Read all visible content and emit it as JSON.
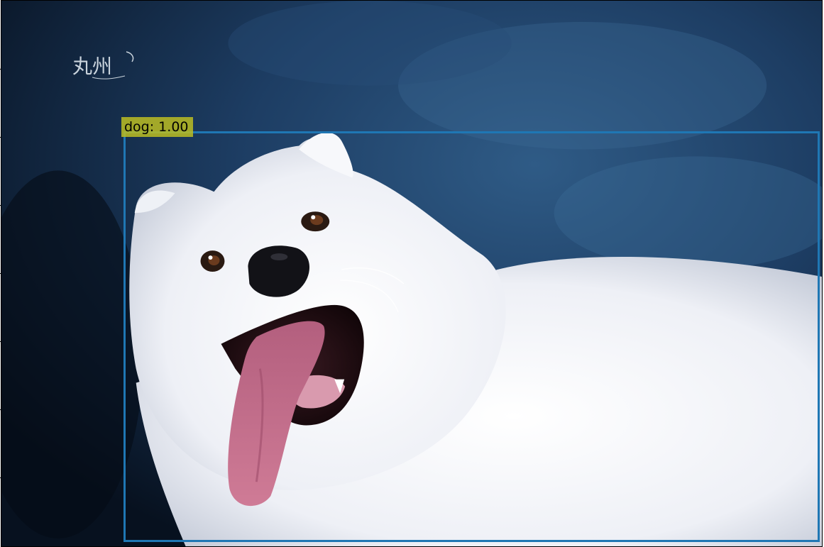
{
  "watermark": {
    "text": "丸州"
  },
  "detections": [
    {
      "label": "dog: 1.00",
      "class": "dog",
      "score": 1.0
    }
  ],
  "colors": {
    "box": "#1f77b4",
    "label_bg": "#bcbd22",
    "background": "#1e3a5c",
    "dog_fur": "#f3f4f8",
    "tongue": "#c86a8a"
  }
}
